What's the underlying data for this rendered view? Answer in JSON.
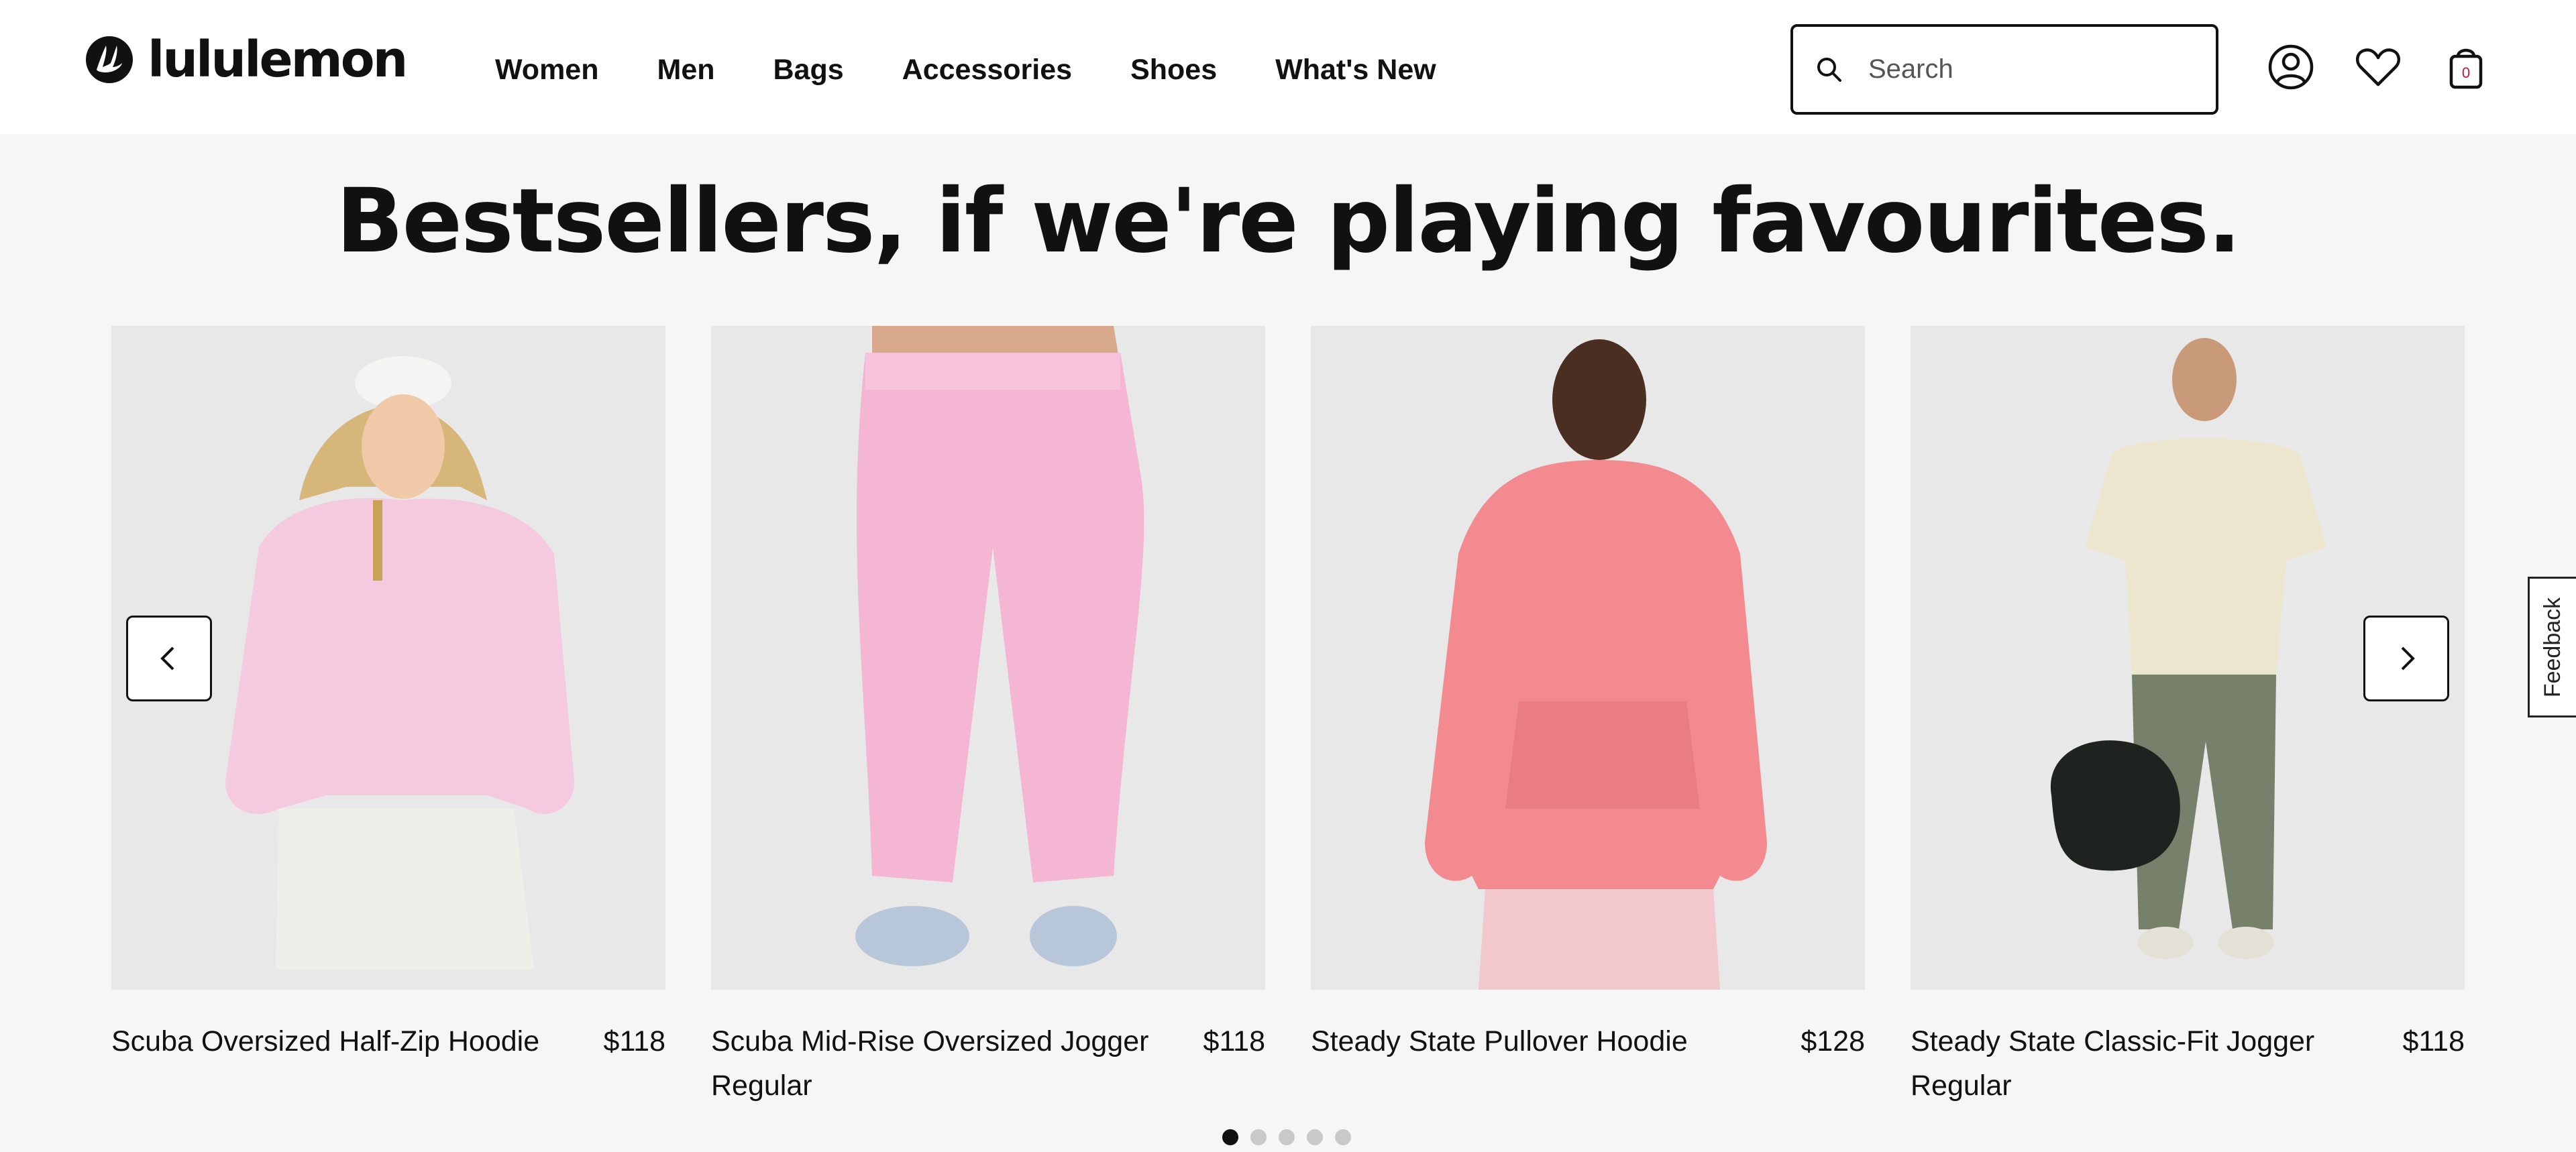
{
  "brand": {
    "name": "lululemon"
  },
  "nav": [
    "Women",
    "Men",
    "Bags",
    "Accessories",
    "Shoes",
    "What's New"
  ],
  "search": {
    "placeholder": "Search",
    "value": ""
  },
  "bag": {
    "count": "0"
  },
  "section": {
    "title": "Bestsellers, if we're playing favourites."
  },
  "products": [
    {
      "name": "Scuba Oversized Half-Zip Hoodie",
      "price": "$118"
    },
    {
      "name": "Scuba Mid-Rise Oversized Jogger Regular",
      "price": "$118"
    },
    {
      "name": "Steady State Pullover Hoodie",
      "price": "$128"
    },
    {
      "name": "Steady State Classic-Fit Jogger Regular",
      "price": "$118"
    }
  ],
  "carousel": {
    "pages": 5,
    "active": 1
  },
  "feedback": {
    "label": "Feedback"
  },
  "colors": {
    "accent": "#d31334",
    "text": "#111111",
    "bg": "#f6f6f6"
  }
}
